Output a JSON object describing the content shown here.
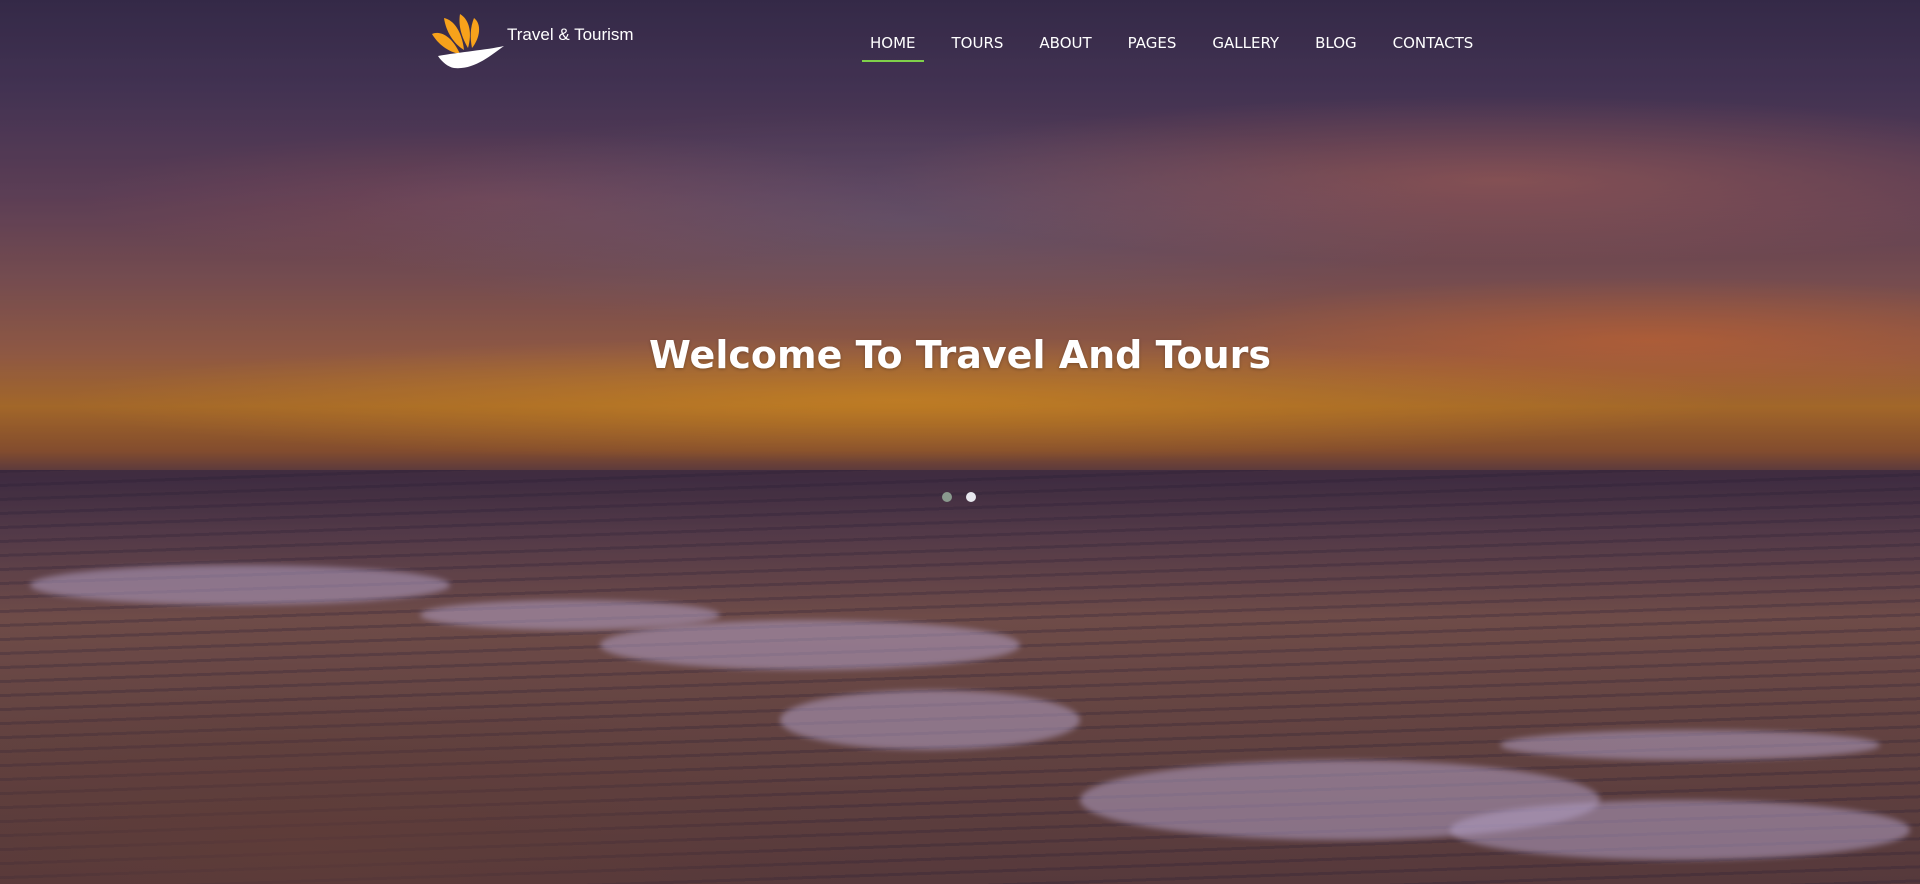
{
  "brand": {
    "name": "Travel & Tourism",
    "logo_icon": "sunrise-wave-logo",
    "logo_colors": [
      "#f7a21b",
      "#ffffff"
    ]
  },
  "nav": {
    "items": [
      {
        "label": "HOME",
        "active": true
      },
      {
        "label": "TOURS",
        "active": false
      },
      {
        "label": "ABOUT",
        "active": false
      },
      {
        "label": "PAGES",
        "active": false
      },
      {
        "label": "GALLERY",
        "active": false
      },
      {
        "label": "BLOG",
        "active": false
      },
      {
        "label": "CONTACTS",
        "active": false
      }
    ],
    "active_underline_color": "#7fd14a"
  },
  "hero": {
    "headline": "Welcome To Travel And Tours",
    "slides": [
      {
        "active": false,
        "color": "#8a9a8e"
      },
      {
        "active": true,
        "color": "#e8e8ee"
      }
    ]
  }
}
